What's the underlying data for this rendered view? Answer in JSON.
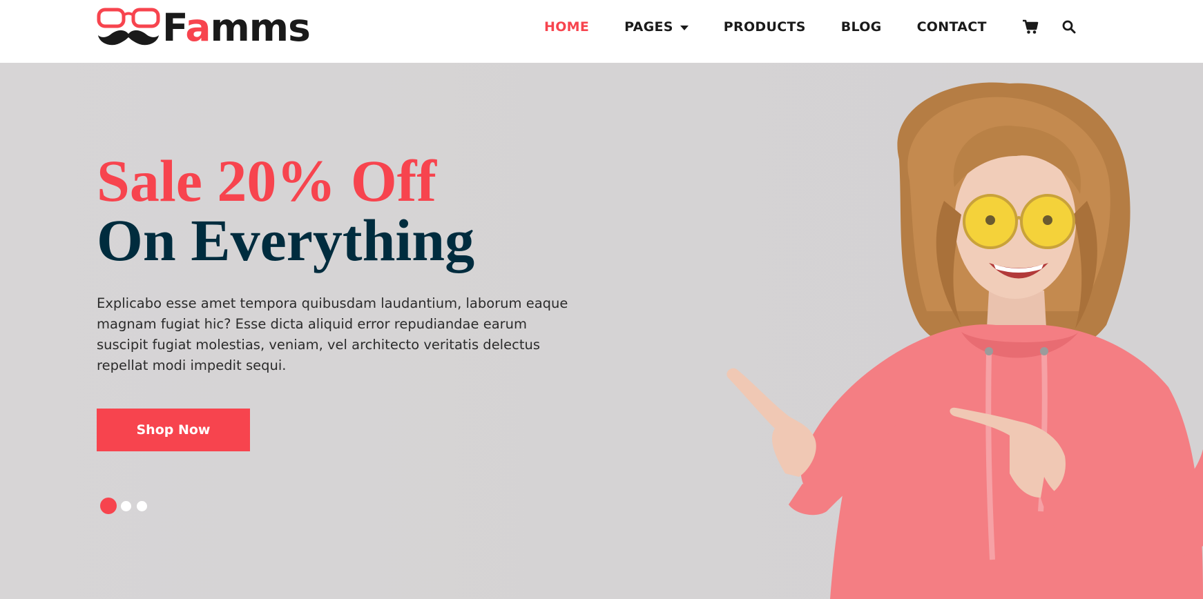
{
  "brand": {
    "name_prefix": "F",
    "name_accent": "a",
    "name_suffix": "mms",
    "accent_color": "#f7444e",
    "dark_color": "#002c3e",
    "logo_icon": "glasses-mustache-icon"
  },
  "nav": {
    "items": [
      {
        "label": "HOME",
        "active": true
      },
      {
        "label": "PAGES",
        "dropdown": true
      },
      {
        "label": "PRODUCTS"
      },
      {
        "label": "BLOG"
      },
      {
        "label": "CONTACT"
      }
    ],
    "cart_icon": "cart-icon",
    "search_icon": "search-icon"
  },
  "hero": {
    "headline_line1": "Sale 20% Off",
    "headline_line2": "On Everything",
    "body": "Explicabo esse amet tempora quibusdam laudantium, laborum eaque magnam fugiat hic? Esse dicta aliquid error repudiandae earum suscipit fugiat molestias, veniam, vel architecto veritatis delectus repellat modi impedit sequi.",
    "cta_label": "Shop Now",
    "slides": 3,
    "active_slide": 1,
    "image": "woman-in-pink-hoodie-pointing"
  }
}
